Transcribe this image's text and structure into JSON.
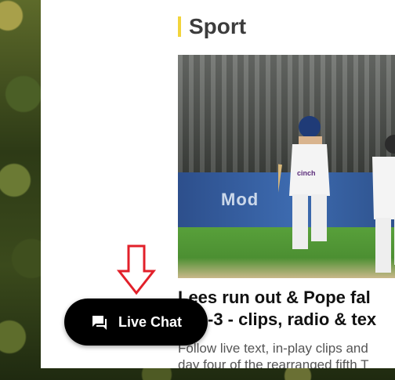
{
  "section": {
    "title": "Sport",
    "accent_color": "#f2d43b"
  },
  "story": {
    "image_alt": "cricket-batsmen-running",
    "board_text": "Mod",
    "shirt_logo": "cinch",
    "headline_line1": "Lees run out & Pope fal",
    "headline_line2": "-3 - clips, radio & tex",
    "summary_line1": "Follow live text, in-play clips and",
    "summary_line2": "day four of the rearranged fifth T"
  },
  "live_chat": {
    "label": "Live Chat",
    "icon": "chat-icon"
  },
  "annotation": {
    "icon": "down-arrow-icon",
    "color": "#e2202a"
  }
}
